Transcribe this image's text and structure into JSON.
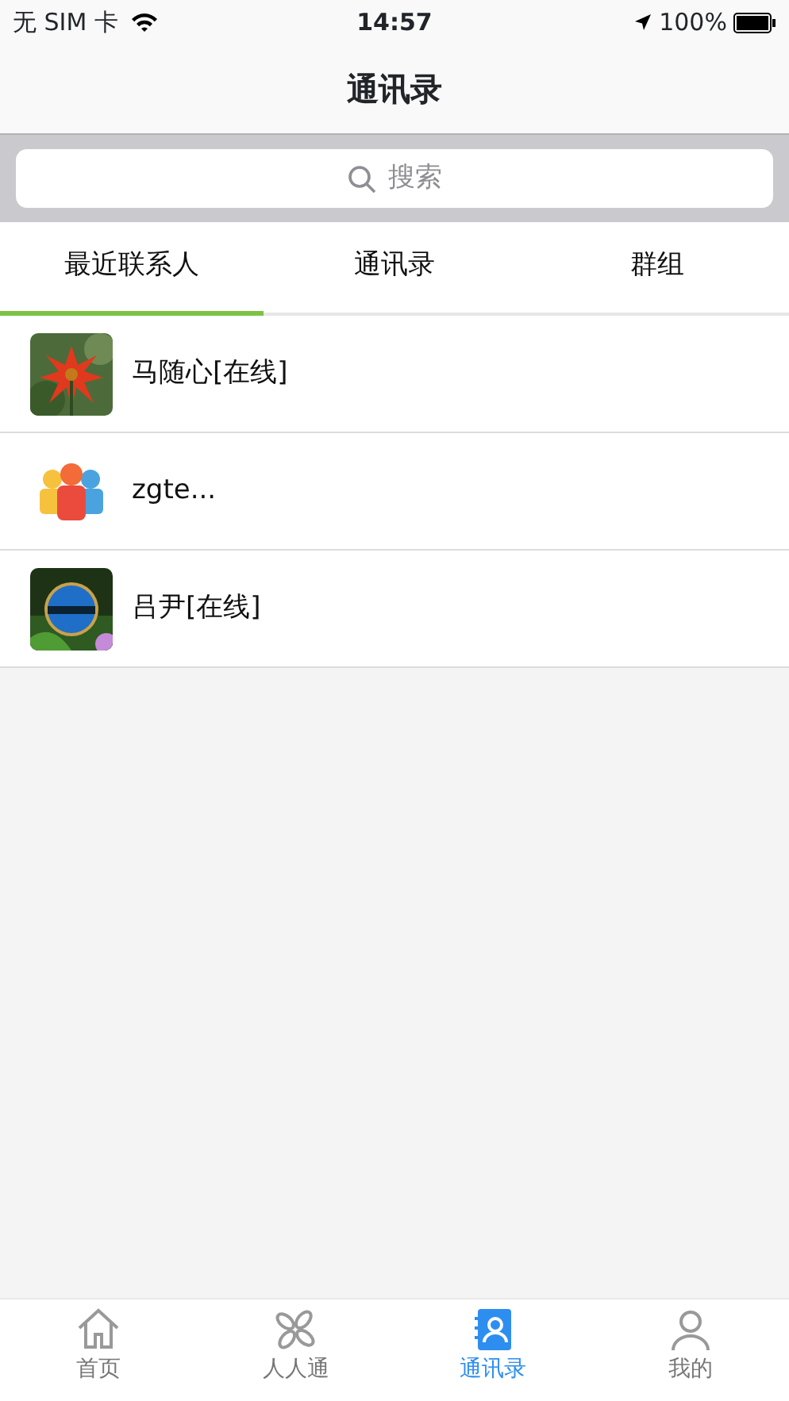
{
  "status_bar": {
    "carrier": "无 SIM 卡",
    "time": "14:57",
    "battery": "100%"
  },
  "title": "通讯录",
  "search": {
    "placeholder": "搜索"
  },
  "tabs": [
    {
      "label": "最近联系人",
      "selected": true
    },
    {
      "label": "通讯录",
      "selected": false
    },
    {
      "label": "群组",
      "selected": false
    }
  ],
  "contacts": [
    {
      "name": "马随心[在线]"
    },
    {
      "name": "zgte..."
    },
    {
      "name": "吕尹[在线]"
    }
  ],
  "bottom_tabs": [
    {
      "label": "首页",
      "selected": false
    },
    {
      "label": "人人通",
      "selected": false
    },
    {
      "label": "通讯录",
      "selected": true
    },
    {
      "label": "我的",
      "selected": false
    }
  ]
}
